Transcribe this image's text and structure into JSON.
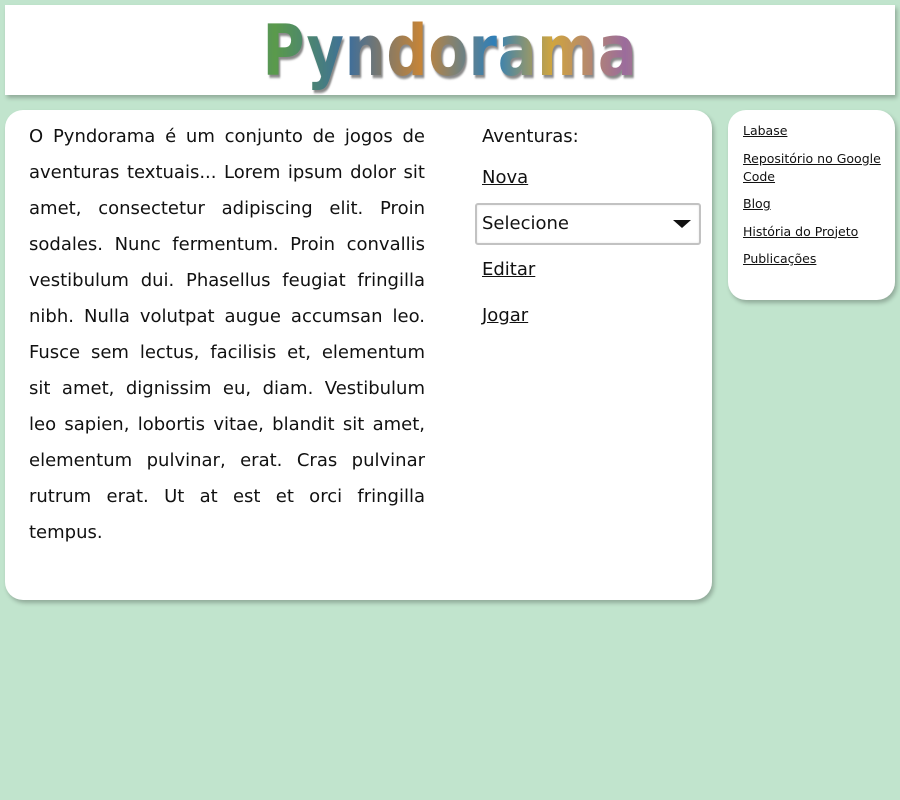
{
  "header": {
    "logo_text": "Pyndorama"
  },
  "main": {
    "intro_text": "O Pyndorama é um conjunto de jogos de aventuras textuais... Lorem ipsum dolor sit amet, consectetur adipiscing elit. Proin sodales. Nunc fermentum. Proin convallis vestibulum dui. Phasellus feugiat fringilla nibh. Nulla volutpat augue accumsan leo. Fusce sem lectus, facilisis et, elementum sit amet, dignissim eu, diam. Vestibulum leo sapien, lobortis vitae, blandit sit amet, elementum pulvinar, erat. Cras pulvinar rutrum erat. Ut at est et orci fringilla tempus."
  },
  "adventures": {
    "title": "Aventuras:",
    "new_label": "Nova",
    "select_value": "Selecione",
    "edit_label": "Editar",
    "play_label": "Jogar"
  },
  "sidebar": {
    "items": [
      {
        "label": "Labase"
      },
      {
        "label": "Repositório no Google Code"
      },
      {
        "label": "Blog"
      },
      {
        "label": "História do Projeto"
      },
      {
        "label": "Publicações"
      }
    ]
  },
  "colors": {
    "background": "#c1e4cd",
    "panel": "#ffffff",
    "text": "#111111"
  },
  "icons": {
    "select_arrow": "chevron-down-icon"
  }
}
